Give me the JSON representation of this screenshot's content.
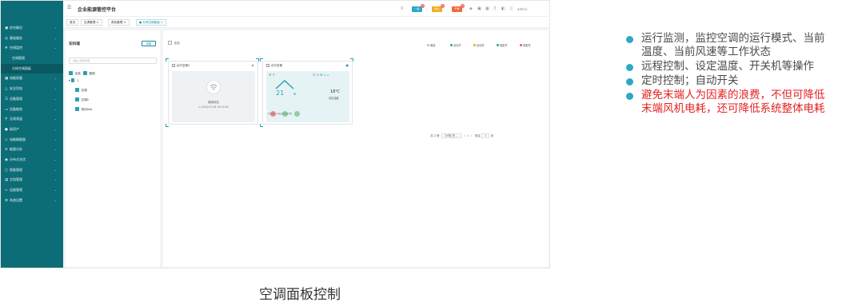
{
  "app": {
    "title": "企业能源管控平台",
    "user": "admin"
  },
  "header_badges": [
    {
      "label": "一般",
      "count": "0",
      "color": "#29a9c7"
    },
    {
      "label": "紧急",
      "count": "0",
      "color": "#f0ad1e"
    },
    {
      "label": "严重",
      "count": "0",
      "color": "#ef6a3a"
    }
  ],
  "tabs": [
    "首页",
    "空调管理",
    "角色管理",
    "分体空调面板"
  ],
  "sidebar": {
    "items": [
      {
        "icon": "▣",
        "label": "综合概况"
      },
      {
        "icon": "◎",
        "label": "基础服务"
      },
      {
        "icon": "❄",
        "label": "空调监控"
      },
      {
        "icon": "",
        "label": "空调管理",
        "sub": true
      },
      {
        "icon": "",
        "label": "分体空调面板",
        "sub": true,
        "active": true
      },
      {
        "icon": "▦",
        "label": "电能质量"
      },
      {
        "icon": "△",
        "label": "安全用电"
      },
      {
        "icon": "☰",
        "label": "设备管理"
      },
      {
        "icon": "▭",
        "label": "设备能效"
      },
      {
        "icon": "⚲",
        "label": "无线测温"
      },
      {
        "icon": "●",
        "label": "碳资产"
      },
      {
        "icon": "◇",
        "label": "电能精细量"
      },
      {
        "icon": "≡",
        "label": "能量分析"
      },
      {
        "icon": "◉",
        "label": "分布式光伏"
      },
      {
        "icon": "◻",
        "label": "智能管理"
      },
      {
        "icon": "▤",
        "label": "文档管理"
      },
      {
        "icon": "∿",
        "label": "运维管理"
      },
      {
        "icon": "⚙",
        "label": "系统设置"
      }
    ]
  },
  "left_panel": {
    "title": "安科瑞",
    "button": "切换",
    "search_placeholder": "请输入搜索内容",
    "filters": [
      "全选",
      "复制"
    ],
    "tree": [
      {
        "label": "1"
      },
      {
        "label": "空调"
      },
      {
        "label": "空调2"
      },
      {
        "label": "测试test"
      }
    ]
  },
  "main_panel": {
    "select_all": "全选",
    "legend": [
      {
        "label": "离线",
        "color": "#bbbbbb"
      },
      {
        "label": "自动开",
        "color": "#2b9fb3"
      },
      {
        "label": "自动关",
        "color": "#f0ad1e"
      },
      {
        "label": "强制开",
        "color": "#2b9fb3"
      },
      {
        "label": "强制关",
        "color": "#ef5350"
      }
    ],
    "cards": [
      {
        "name": "大厅空调1",
        "status": "离线状态",
        "time": "2024-01-08 16:14:00"
      },
      {
        "name": "大厅空调",
        "temp": "21",
        "set_temp": "18℃",
        "set_label": "设定温度",
        "buttons": [
          "制冷模式",
          "功能设置",
          "高温预警"
        ]
      }
    ],
    "pager": {
      "total": "共 2 条",
      "size": "24条/页",
      "page": "1",
      "goto": "前往",
      "goto_page": "1",
      "unit": "页"
    }
  },
  "notes": [
    {
      "text": "运行监测，监控空调的运行模式、当前温度、当前风速等工作状态",
      "warn": false
    },
    {
      "text": "远程控制、设定温度、开关机等操作",
      "warn": false
    },
    {
      "text": "定时控制；自动开关",
      "warn": false
    },
    {
      "text": "避免末端人为因素的浪费，不但可降低末端风机电耗，还可降低系统整体电耗",
      "warn": true
    }
  ],
  "caption": "空调面板控制"
}
